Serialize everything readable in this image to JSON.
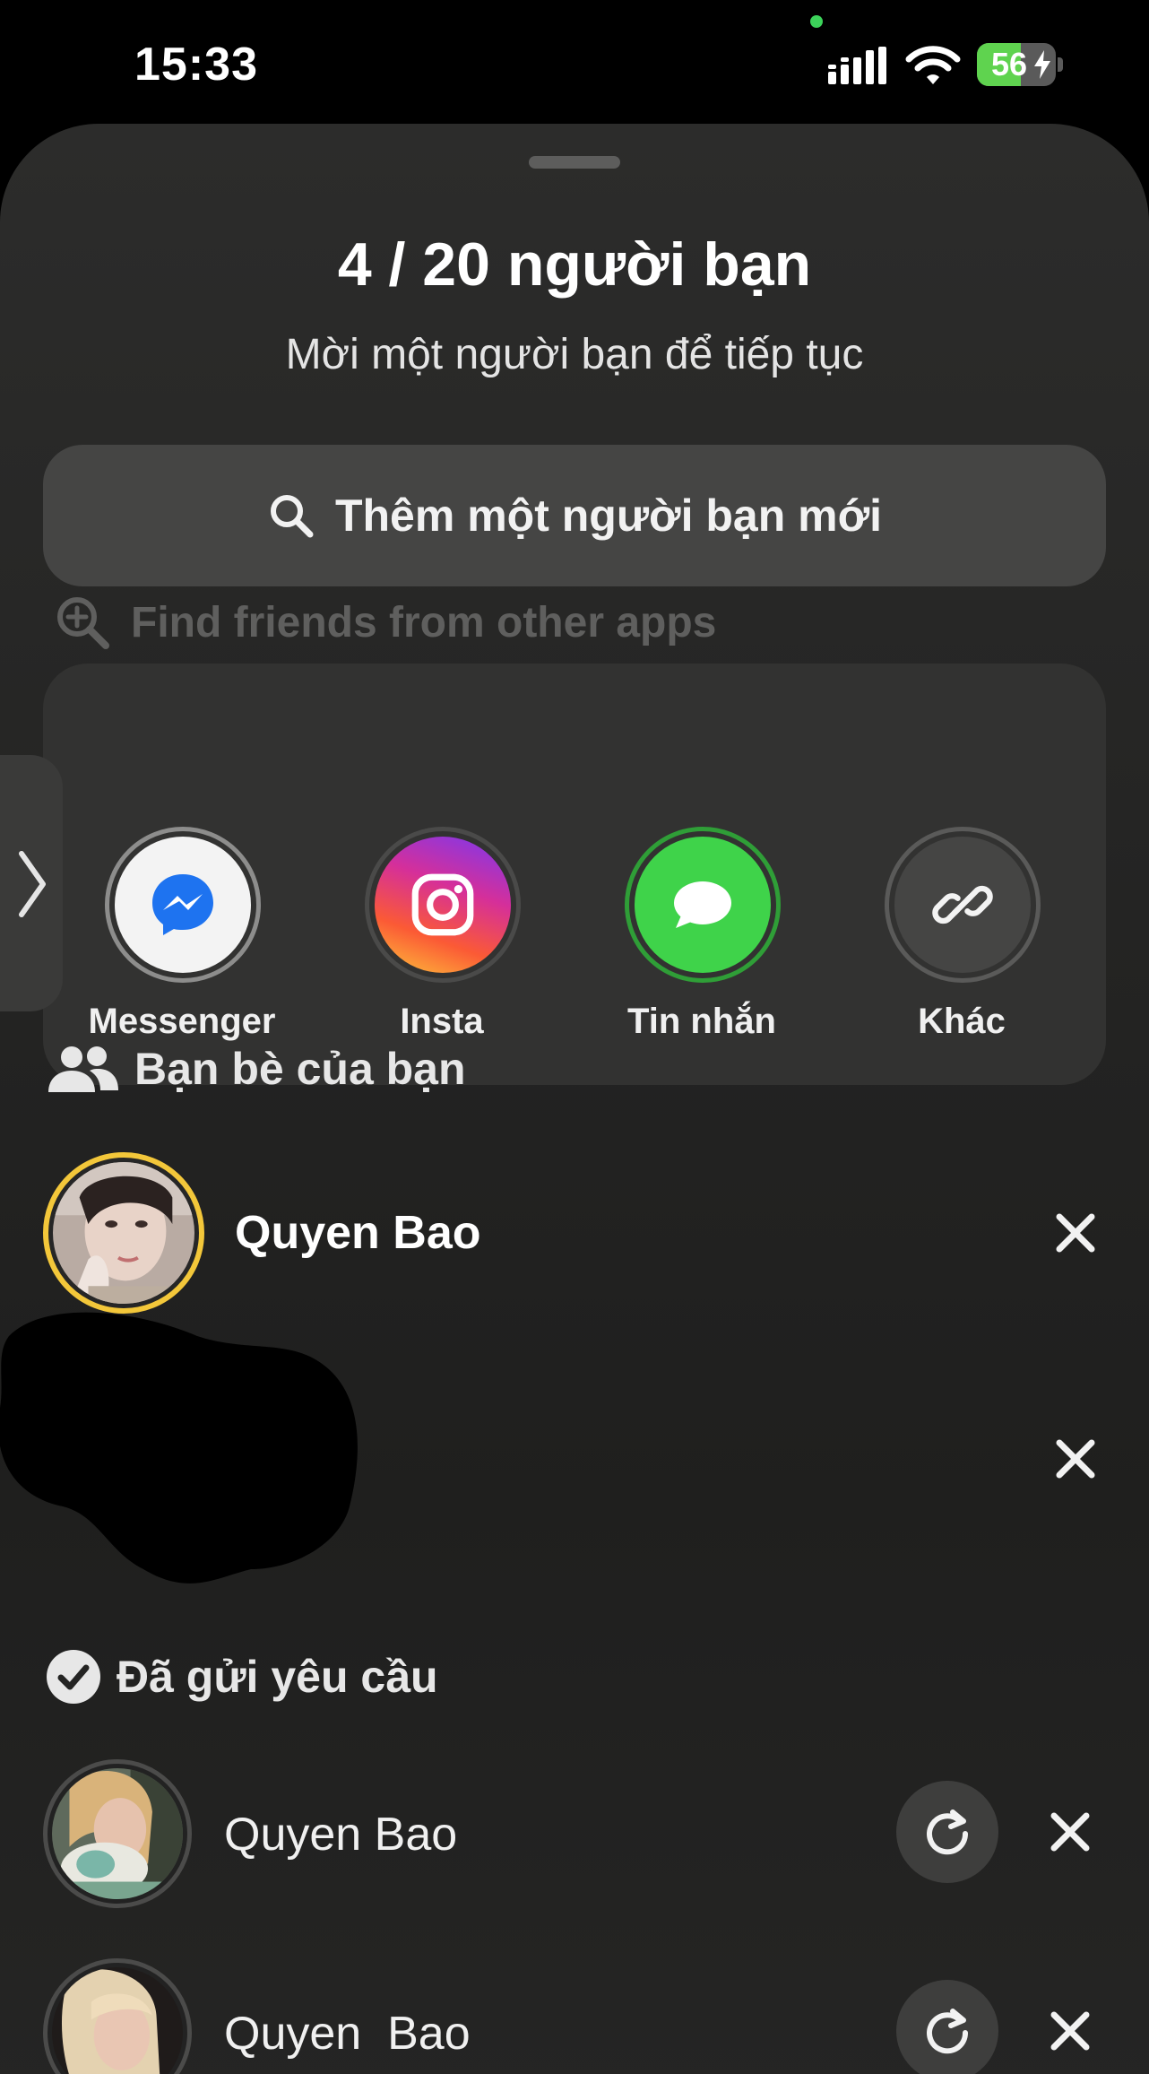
{
  "status_bar": {
    "time": "15:33",
    "battery_percent": "56",
    "battery_level": 0.56,
    "icons": [
      "signal-icon",
      "wifi-icon",
      "battery-charging-icon"
    ],
    "colors": {
      "battery_fill": "#5fd34f",
      "dot": "#3cd35a"
    }
  },
  "sheet": {
    "title": "4 / 20 người bạn",
    "subtitle": "Mời một người bạn để tiếp tục"
  },
  "search": {
    "label": "Thêm một người bạn mới",
    "icon": "search-icon"
  },
  "find_other": {
    "label": "Find friends from other apps",
    "icon": "zoom-plus-icon"
  },
  "share_targets": [
    {
      "label": "Messenger",
      "icon": "messenger-icon"
    },
    {
      "label": "Insta",
      "icon": "instagram-icon"
    },
    {
      "label": "Tin nhắn",
      "icon": "message-bubble-icon"
    },
    {
      "label": "Khác",
      "icon": "link-icon"
    }
  ],
  "friends_section": {
    "label": "Bạn bè của bạn",
    "icon": "people-icon",
    "friends": [
      {
        "name": "Quyen Bao"
      },
      {
        "name": ""
      }
    ]
  },
  "sent_section": {
    "label": "Đã gửi yêu cầu",
    "icon": "check-circle-icon",
    "requests": [
      {
        "name": "Quyen Bao"
      },
      {
        "name": "Quyen  Bao"
      }
    ]
  },
  "colors": {
    "accent_gold": "#f3c73a",
    "messages_green": "#3fd34a"
  }
}
